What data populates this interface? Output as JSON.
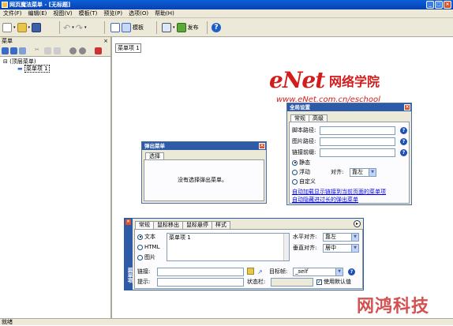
{
  "window": {
    "title": "网页魔法菜单 - [无标题]"
  },
  "menubar": [
    "文件(F)",
    "编辑(E)",
    "视图(V)",
    "模板(T)",
    "预览(P)",
    "选项(O)",
    "帮助(H)"
  ],
  "toolbar": {
    "template_label": "模板",
    "publish_label": "发布"
  },
  "left_panel": {
    "title": "菜单",
    "tree_root": "(顶层菜单)",
    "tree_child": "菜单项 1"
  },
  "canvas": {
    "menu_item": "菜单项 1"
  },
  "logo": {
    "brand": "eNet",
    "chinese": "网络学院",
    "url": "www.eNet.com.cn/eschool"
  },
  "global_settings": {
    "title": "全局设置",
    "tabs": [
      "常规",
      "高级"
    ],
    "script_path_label": "脚本路径:",
    "image_path_label": "图片路径:",
    "link_prefix_label": "链接前缀:",
    "radio_static": "静态",
    "radio_float": "浮动",
    "align_label": "对齐:",
    "align_value": "靠左",
    "radio_custom": "自定义",
    "link1": "自动加载显示链接到当前页面的菜单项",
    "link2": "自动隐藏进过长的弹出菜单"
  },
  "popup_menu_dialog": {
    "title": "弹出菜单",
    "tab": "选择",
    "message": "没有选择弹出菜单。"
  },
  "menu_item_panel": {
    "side_label": "菜单项",
    "tabs": [
      "常规",
      "鼠标移出",
      "鼠标悬停",
      "样式"
    ],
    "radio_text": "文本",
    "radio_html": "HTML",
    "radio_image": "图片",
    "text_value": "菜单项 1",
    "halign_label": "水平对齐:",
    "halign_value": "靠左",
    "valign_label": "垂直对齐:",
    "valign_value": "居中",
    "link_label": "链接:",
    "target_label": "目标帧:",
    "target_value": "_self",
    "tooltip_label": "提示:",
    "status_label": "状态栏:",
    "default_checkbox": "使用默认值"
  },
  "statusbar": {
    "text": "就绪"
  },
  "watermark": "网鸿科技"
}
